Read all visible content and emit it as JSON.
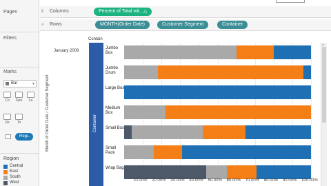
{
  "left_panel": {
    "pages_title": "Pages",
    "filters_title": "Filters",
    "marks_title": "Marks",
    "marks_type": "Bar",
    "mark_buttons": [
      "Co",
      "Size",
      "La",
      "De",
      "To"
    ],
    "color_pill": "Regi..",
    "legend": {
      "title": "Region",
      "items": [
        {
          "label": "Central",
          "color": "#1f6fb4"
        },
        {
          "label": "East",
          "color": "#f57f17"
        },
        {
          "label": "South",
          "color": "#a9a9a9"
        },
        {
          "label": "West",
          "color": "#4d5968"
        }
      ]
    }
  },
  "shelves": {
    "columns_label": "Columns",
    "columns_pills": [
      "Percent of Total wit.. △"
    ],
    "rows_label": "Rows",
    "rows_pills": [
      "MONTH(Order Date)",
      "Customer Segment",
      "Container"
    ]
  },
  "view": {
    "row_header_title": "Contain",
    "vertical_axis_title": "Month of Order Date / Customer Segment",
    "month": "January 2009",
    "segment_band": "Container",
    "x_ticks": [
      "10.00%",
      "20.00%",
      "30.00%",
      "40.00%",
      "50.00%",
      "60.00%",
      "70.00%",
      "80.00%",
      "90.00%",
      "100.00%"
    ]
  },
  "chart_data": {
    "type": "bar",
    "stacked": true,
    "orientation": "horizontal",
    "categories": [
      "Jumbo Box",
      "Jumbo Drum",
      "Large Box",
      "Medium Box",
      "Small Box",
      "Small Pack",
      "Wrap Bag"
    ],
    "series": [
      {
        "name": "West",
        "color": "#4d5968",
        "values": [
          0,
          0,
          0,
          0,
          4,
          0,
          44
        ]
      },
      {
        "name": "South",
        "color": "#a9a9a9",
        "values": [
          60,
          18,
          0,
          22,
          38,
          16,
          11
        ]
      },
      {
        "name": "East",
        "color": "#f57f17",
        "values": [
          20,
          78,
          0,
          78,
          23,
          15,
          16
        ]
      },
      {
        "name": "Central",
        "color": "#1f6fb4",
        "values": [
          20,
          4,
          100,
          0,
          35,
          69,
          29
        ]
      }
    ],
    "xlim": [
      0,
      100
    ]
  }
}
